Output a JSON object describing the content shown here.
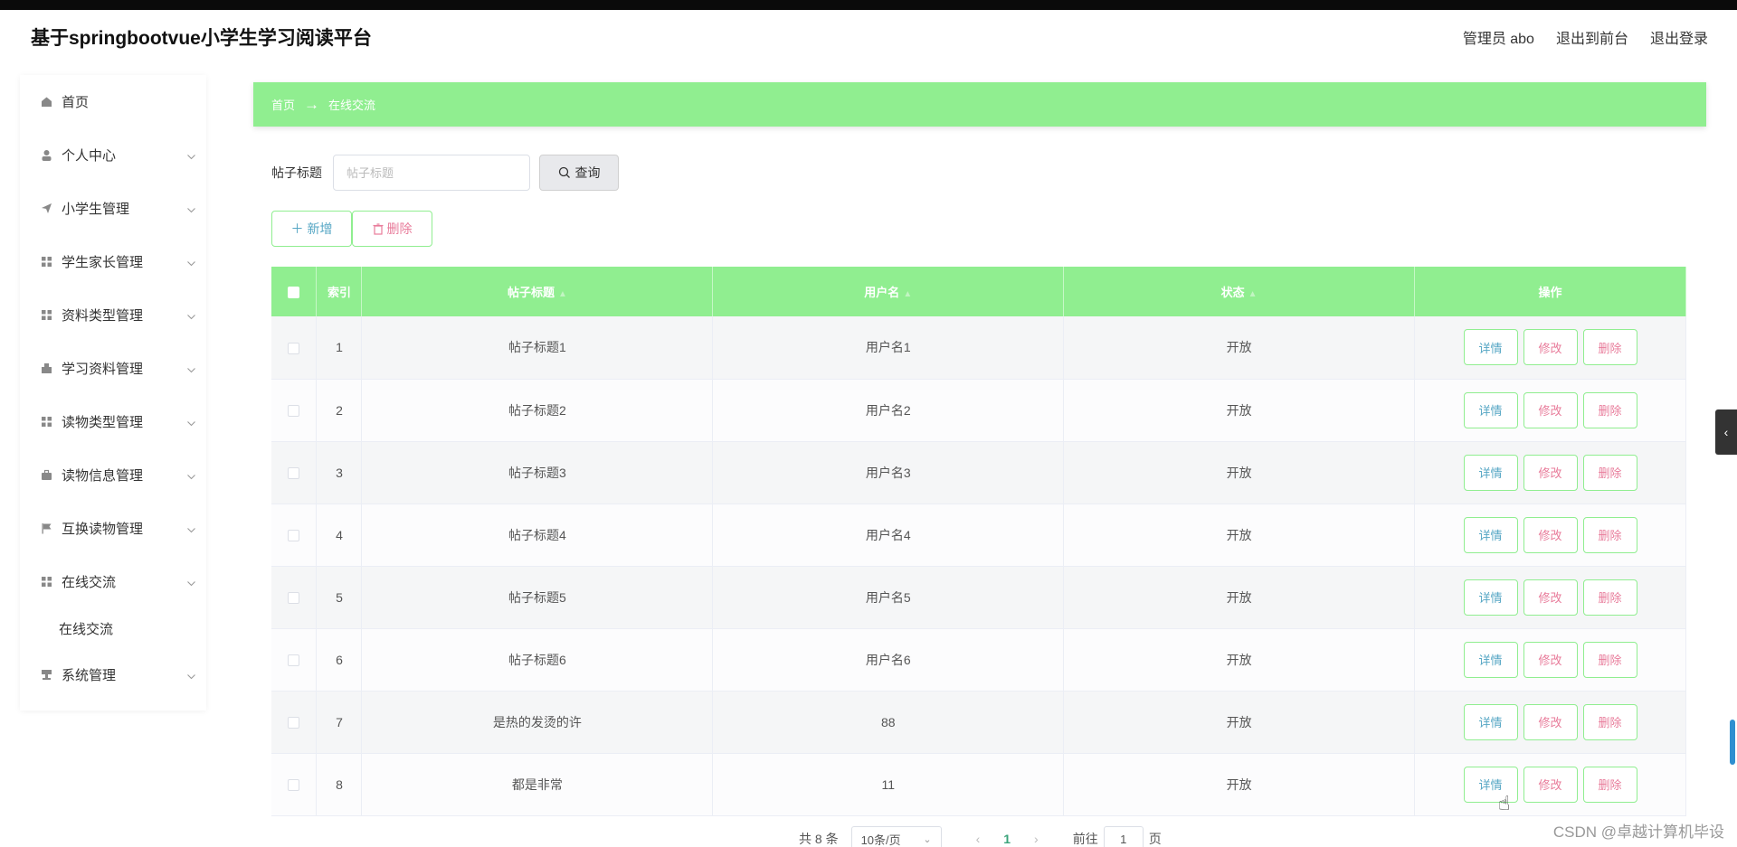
{
  "header": {
    "brand": "基于springbootvue小学生学习阅读平台",
    "user": "管理员 abo",
    "to_front": "退出到前台",
    "logout": "退出登录"
  },
  "sidebar": {
    "items": [
      {
        "label": "首页",
        "icon": "home-icon"
      },
      {
        "label": "个人中心",
        "icon": "user-icon"
      },
      {
        "label": "小学生管理",
        "icon": "send-icon"
      },
      {
        "label": "学生家长管理",
        "icon": "grid-icon"
      },
      {
        "label": "资料类型管理",
        "icon": "grid-icon"
      },
      {
        "label": "学习资料管理",
        "icon": "building-icon"
      },
      {
        "label": "读物类型管理",
        "icon": "grid-icon"
      },
      {
        "label": "读物信息管理",
        "icon": "briefcase-icon"
      },
      {
        "label": "互换读物管理",
        "icon": "flag-icon"
      },
      {
        "label": "在线交流",
        "icon": "grid-icon"
      }
    ],
    "sub_item": "在线交流",
    "system": {
      "label": "系统管理",
      "icon": "stamp-icon"
    }
  },
  "breadcrumb": {
    "home": "首页",
    "arrow": "→",
    "current": "在线交流"
  },
  "search": {
    "label": "帖子标题",
    "placeholder": "帖子标题",
    "button": "查询"
  },
  "actions": {
    "add": "新增",
    "delete": "删除"
  },
  "table": {
    "columns": [
      "索引",
      "帖子标题",
      "用户名",
      "状态",
      "操作"
    ],
    "op_labels": {
      "detail": "详情",
      "edit": "修改",
      "delete": "删除"
    },
    "rows": [
      {
        "index": "1",
        "title": "帖子标题1",
        "username": "用户名1",
        "status": "开放"
      },
      {
        "index": "2",
        "title": "帖子标题2",
        "username": "用户名2",
        "status": "开放"
      },
      {
        "index": "3",
        "title": "帖子标题3",
        "username": "用户名3",
        "status": "开放"
      },
      {
        "index": "4",
        "title": "帖子标题4",
        "username": "用户名4",
        "status": "开放"
      },
      {
        "index": "5",
        "title": "帖子标题5",
        "username": "用户名5",
        "status": "开放"
      },
      {
        "index": "6",
        "title": "帖子标题6",
        "username": "用户名6",
        "status": "开放"
      },
      {
        "index": "7",
        "title": "是热的发烫的许",
        "username": "88",
        "status": "开放"
      },
      {
        "index": "8",
        "title": "都是非常",
        "username": "11",
        "status": "开放"
      }
    ]
  },
  "pager": {
    "total": "共 8 条",
    "page_size": "10条/页",
    "current": "1",
    "goto_label": "前往",
    "goto_value": "1",
    "goto_suffix": "页"
  },
  "watermark": "CSDN @卓越计算机毕设",
  "colors": {
    "accent": "#90ee90",
    "detail_text": "#55a6c4",
    "danger_text": "#e87b9a"
  }
}
